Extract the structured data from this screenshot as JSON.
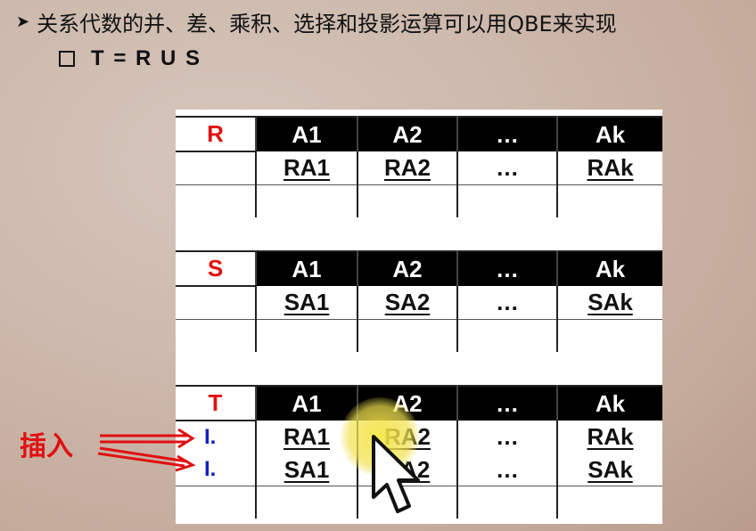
{
  "heading": {
    "bullet_text": "关系代数的并、差、乘积、选择和投影运算可以用QBE来实现",
    "sub_text": "T = R U S"
  },
  "tables": [
    {
      "name": "R",
      "columns": [
        "A1",
        "A2",
        "…",
        "Ak"
      ],
      "rows": [
        {
          "op": "",
          "cells": [
            "RA1",
            "RA2",
            "…",
            "RAk"
          ]
        },
        {
          "op": "",
          "cells": [
            "",
            "",
            "",
            ""
          ]
        }
      ]
    },
    {
      "name": "S",
      "columns": [
        "A1",
        "A2",
        "…",
        "Ak"
      ],
      "rows": [
        {
          "op": "",
          "cells": [
            "SA1",
            "SA2",
            "…",
            "SAk"
          ]
        },
        {
          "op": "",
          "cells": [
            "",
            "",
            "",
            ""
          ]
        }
      ]
    },
    {
      "name": "T",
      "columns": [
        "A1",
        "A2",
        "…",
        "Ak"
      ],
      "rows": [
        {
          "op": "I.",
          "cells": [
            "RA1",
            "RA2",
            "…",
            "RAk"
          ]
        },
        {
          "op": "I.",
          "cells": [
            "SA1",
            "SA2",
            "…",
            "SAk"
          ]
        },
        {
          "op": "",
          "cells": [
            "",
            "",
            "",
            ""
          ]
        }
      ]
    }
  ],
  "annotation": {
    "label": "插入",
    "color": "#e01010"
  },
  "colors": {
    "table_name": "#e01010",
    "operator": "#1020c0",
    "header_bg": "#000000"
  }
}
